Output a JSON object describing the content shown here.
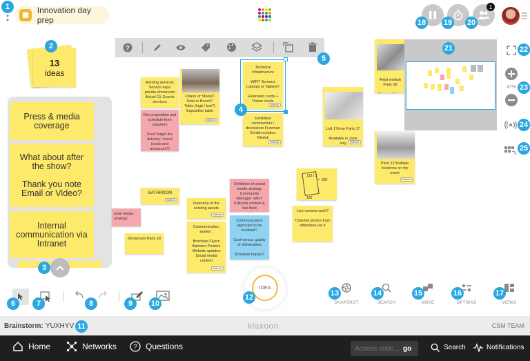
{
  "header": {
    "board_title": "Innovation day prep",
    "notification_count": "1"
  },
  "ideas_counter": {
    "count": "13",
    "label": "ideas"
  },
  "side_panel": {
    "notes": [
      "Press & media coverage",
      "What about after the show?\n\nThank you note Email or Video?",
      "Internal communication via Intranet"
    ]
  },
  "zoom": {
    "level": "47%"
  },
  "badges": [
    "1",
    "2",
    "3",
    "4",
    "5",
    "6",
    "7",
    "8",
    "9",
    "10",
    "11",
    "12",
    "13",
    "14",
    "15",
    "16",
    "17",
    "18",
    "19",
    "20",
    "21",
    "22",
    "23",
    "24",
    "25"
  ],
  "notes": {
    "renting": "Renting services Service expo private-showroom Aktuel GL Events services",
    "chairs": "Chairs or Stools? Sofa or Bench? Table (high / low?) Exposition table",
    "proposition": "Get proposition and schedule from suppliers\n\nDon't forget the delivery / travel (costs and resources?)",
    "technical": "Technical infrastructure\n\nWiFi? Screens Labtops or Tablets?\n\nExtension cords + Power cords",
    "exhibition": "Exhibition constructors / decorators Freeman Exhibit solution Nimlok",
    "loft": "Loft 17ème Paris 17\n\nAvailable in June only",
    "artist": "Artist worksh Paris 09\n\nClose at 11 pm",
    "paris11": "Paris 11 Multiple locations on my event",
    "bathroom": "BATHROOM",
    "social_left": "ocial media strategy",
    "inventory": "Inventory of the existing assets",
    "communication_assets": "Communication assets :\n\nBrochure Flyers Banners Posters Website updates Social media content",
    "showroom": "Showroom Paris 18",
    "definition": "Definition of social media strategy Community Manager: who? Editorial content & live feed",
    "agencies": "Communication agencies to be involved?\n\nCost versus quality of deliverables\n\nSchedule impact?",
    "livecam": "Live camera work?\n\nChannel photos from attendees via #",
    "tag_label": "Material"
  },
  "sketch": {
    "label1": "133 / 1",
    "label2": "200",
    "label3": "120"
  },
  "idea_button": {
    "label": "IDEA"
  },
  "tools": {
    "snapshot": "SNAPSHOT",
    "search": "SEARCH",
    "move": "MOVE",
    "options": "OPTIONS",
    "views": "VIEWS"
  },
  "footer": {
    "brainstorm_label": "Brainstorm:",
    "brainstorm_code": "YUXHYV",
    "brand": "klaxoon",
    "team": "CSM TEAM"
  },
  "nav": {
    "home": "Home",
    "networks": "Networks",
    "questions": "Questions",
    "access_placeholder": "Access code...",
    "go": "go",
    "search": "Search",
    "notifications": "Notifications"
  },
  "colors": {
    "accent": "#2aa7e0",
    "note_yellow": "#fde96a",
    "note_pink": "#f5a7ad",
    "note_blue": "#8fd3f3",
    "navbar": "#1f1f1f"
  }
}
